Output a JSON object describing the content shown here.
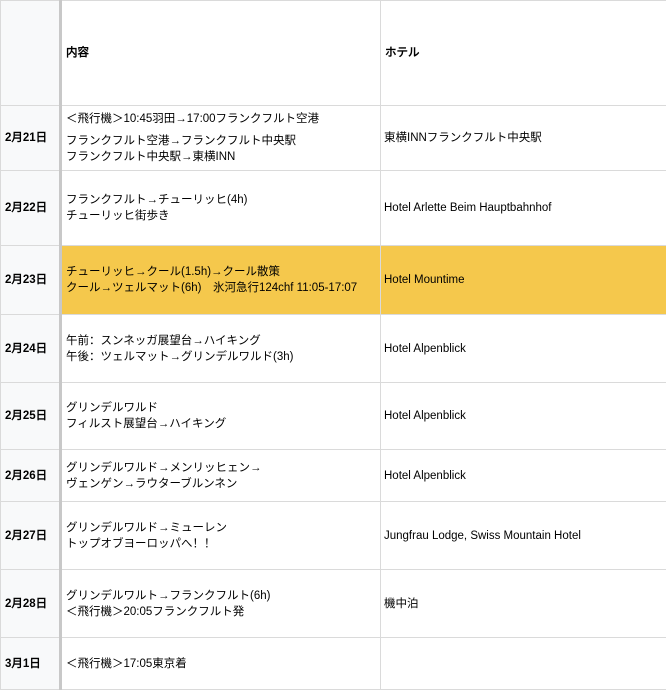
{
  "header": {
    "date": "",
    "content": "内容",
    "hotel": "ホテル"
  },
  "rows": [
    {
      "date": "2月21日",
      "content": [
        "＜飛行機＞10:45羽田→17:00フランクフルト空港",
        "フランクフルト空港→フランクフルト中央駅",
        "フランクフルト中央駅→東横INN"
      ],
      "hotel": "東横INNフランクフルト中央駅"
    },
    {
      "date": "2月22日",
      "content": [
        "フランクフルト→チューリッヒ(4h)",
        "チューリッヒ街歩き"
      ],
      "hotel": "Hotel Arlette Beim Hauptbahnhof"
    },
    {
      "date": "2月23日",
      "content": [
        "チューリッヒ→クール(1.5h)→クール散策",
        "クール→ツェルマット(6h)　氷河急行124chf 11:05-17:07"
      ],
      "hotel": "Hotel Mountime",
      "highlight": true
    },
    {
      "date": "2月24日",
      "content": [
        "午前：スンネッガ展望台→ハイキング",
        "午後：ツェルマット→グリンデルワルド(3h)"
      ],
      "hotel": "Hotel Alpenblick"
    },
    {
      "date": "2月25日",
      "content": [
        "グリンデルワルド",
        "フィルスト展望台→ハイキング"
      ],
      "hotel": "Hotel Alpenblick"
    },
    {
      "date": "2月26日",
      "content": [
        "グリンデルワルド→メンリッヒェン→",
        "ヴェンゲン→ラウターブルンネン"
      ],
      "hotel": "Hotel Alpenblick"
    },
    {
      "date": "2月27日",
      "content": [
        "グリンデルワルド→ミューレン",
        "トップオブヨーロッパへ！！"
      ],
      "hotel": "Jungfrau Lodge, Swiss Mountain Hotel"
    },
    {
      "date": "2月28日",
      "content": [
        "グリンデルワルト→フランクフルト(6h)",
        "＜飛行機＞20:05フランクフルト発"
      ],
      "hotel": "機中泊"
    },
    {
      "date": "3月1日",
      "content": [
        "＜飛行機＞17:05東京着"
      ],
      "hotel": ""
    }
  ],
  "colors": {
    "highlight": "#f5c84c",
    "gridline": "#dadada"
  }
}
